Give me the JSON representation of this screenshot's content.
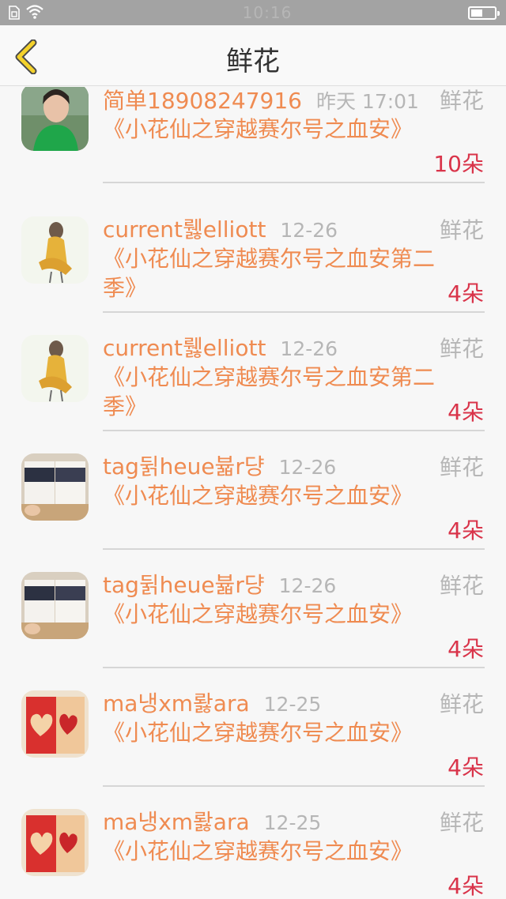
{
  "status_bar": {
    "time": "10:16"
  },
  "header": {
    "title": "鲜花"
  },
  "items": [
    {
      "name": "简单18908247916",
      "time": "昨天 17:01",
      "type": "鲜花",
      "book": "《小花仙之穿越赛尔号之血安》",
      "count": "10朵",
      "avatar": "avatar-girl-green"
    },
    {
      "name": "current뤯elliott",
      "time": "12-26",
      "type": "鲜花",
      "book": "《小花仙之穿越赛尔号之血安第二季》",
      "count": "4朵",
      "avatar": "avatar-sketch"
    },
    {
      "name": "current뤯elliott",
      "time": "12-26",
      "type": "鲜花",
      "book": "《小花仙之穿越赛尔号之血安第二季》",
      "count": "4朵",
      "avatar": "avatar-sketch"
    },
    {
      "name": "tag뒭heue뷻r댱",
      "time": "12-26",
      "type": "鲜花",
      "book": "《小花仙之穿越赛尔号之血安》",
      "count": "4朵",
      "avatar": "avatar-book"
    },
    {
      "name": "tag뒭heue뷻r댱",
      "time": "12-26",
      "type": "鲜花",
      "book": "《小花仙之穿越赛尔号之血安》",
      "count": "4朵",
      "avatar": "avatar-book"
    },
    {
      "name": "ma냉xm뢇ara",
      "time": "12-25",
      "type": "鲜花",
      "book": "《小花仙之穿越赛尔号之血安》",
      "count": "4朵",
      "avatar": "avatar-heart"
    },
    {
      "name": "ma냉xm뢇ara",
      "time": "12-25",
      "type": "鲜花",
      "book": "《小花仙之穿越赛尔号之血安》",
      "count": "4朵",
      "avatar": "avatar-heart"
    }
  ]
}
